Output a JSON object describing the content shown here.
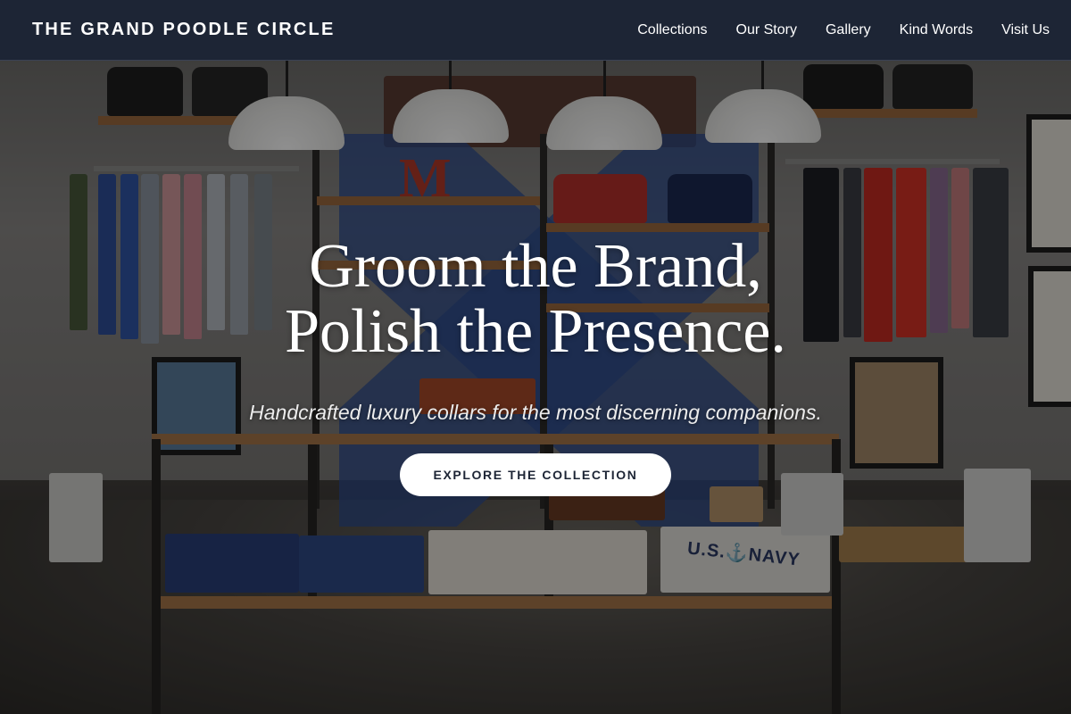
{
  "nav": {
    "brand": "THE GRAND POODLE CIRCLE",
    "links": [
      "Collections",
      "Our Story",
      "Gallery",
      "Kind Words",
      "Visit Us"
    ]
  },
  "hero": {
    "headline_line1": "Groom the Brand,",
    "headline_line2": "Polish the Presence.",
    "subheadline": "Handcrafted luxury collars for the most discerning companions.",
    "cta_label": "EXPLORE THE COLLECTION",
    "background_scene": "clothing-boutique-photo"
  },
  "scene_text": {
    "shirt_print": "U.S.⚓NAVY"
  },
  "colors": {
    "nav_background": "#1d2535",
    "cta_background": "#ffffff",
    "cta_text": "#1d2535",
    "text_primary": "#ffffff"
  }
}
